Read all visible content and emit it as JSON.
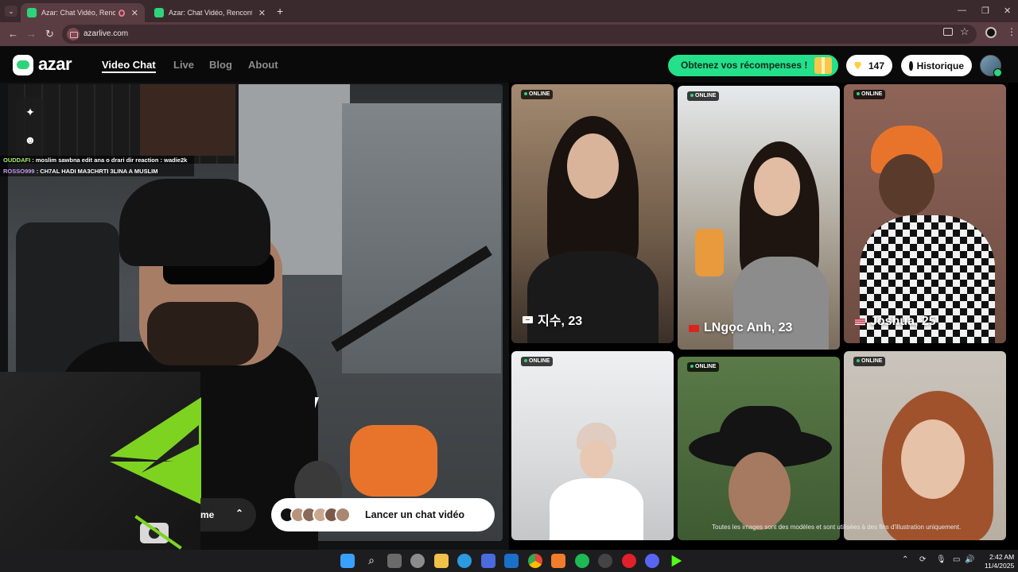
{
  "browser": {
    "tabs": [
      {
        "label": "Azar: Chat Vidéo, Rencontre"
      },
      {
        "label": "Azar: Chat Vidéo, Rencontrer de"
      }
    ],
    "url": "azarlive.com"
  },
  "header": {
    "logo": "azar",
    "nav": [
      {
        "label": "Video Chat",
        "active": true
      },
      {
        "label": "Live"
      },
      {
        "label": "Blog"
      },
      {
        "label": "About"
      }
    ],
    "reward_label": "Obtenez vos récompenses !",
    "gems": "147",
    "history_label": "Historique"
  },
  "stream": {
    "chat": [
      {
        "user": "OUDDAFI",
        "text": ": moslim sawbna edit ana o drari dir reaction : wadie2k"
      },
      {
        "user": "ROSSO999",
        "text": ": CH7AL HADI MA3CHRTI 3LINA A MUSLIM"
      }
    ]
  },
  "controls": {
    "gender_label": "me",
    "start_label": "Lancer un chat vidéo"
  },
  "profiles": [
    {
      "status": "ONLINE",
      "name": "지수, 23",
      "flag": "kr"
    },
    {
      "status": "ONLINE",
      "name": "LNgọc Anh, 23",
      "flag": "vn"
    },
    {
      "status": "ONLINE",
      "name": "Joshua, 25",
      "flag": "us"
    },
    {
      "status": "ONLINE",
      "name": ""
    },
    {
      "status": "ONLINE",
      "name": ""
    },
    {
      "status": "ONLINE",
      "name": ""
    }
  ],
  "disclaimer": "Toutes les images sont des modèles et sont utilisées à des fins d'illustration uniquement.",
  "taskbar": {
    "time": "2:42 AM",
    "date": "11/4/2025"
  },
  "colors": {
    "brand_green": "#24e08a",
    "online_dot": "#2ed47a",
    "overlay_green": "#7ed321"
  }
}
